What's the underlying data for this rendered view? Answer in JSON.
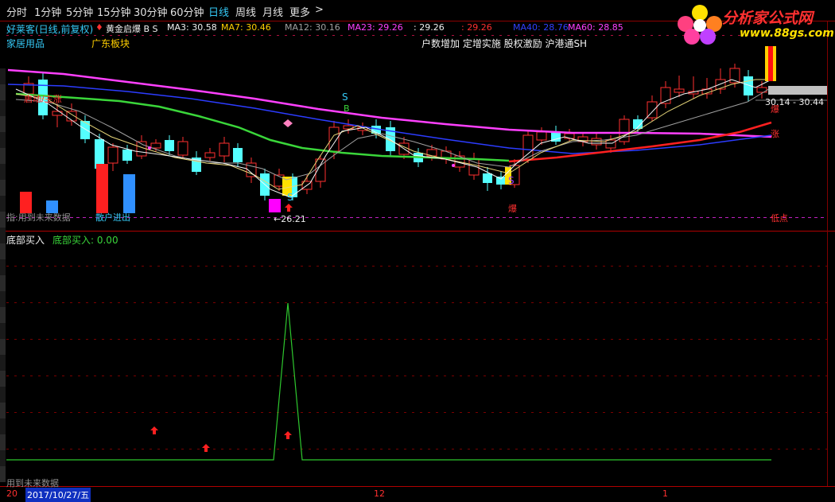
{
  "periods": [
    {
      "label": "分时",
      "active": false
    },
    {
      "label": "1分钟",
      "active": false
    },
    {
      "label": "5分钟",
      "active": false
    },
    {
      "label": "15分钟",
      "active": false
    },
    {
      "label": "30分钟",
      "active": false
    },
    {
      "label": "60分钟",
      "active": false
    },
    {
      "label": "日线",
      "active": true
    },
    {
      "label": "周线",
      "active": false
    },
    {
      "label": "月线",
      "active": false
    },
    {
      "label": "更多",
      "active": false
    }
  ],
  "more_arrow": ">",
  "header": {
    "stock": "好莱客(日线,前复权)",
    "indicator": "黄金启爆 B S",
    "ma3": "MA3: 30.58",
    "ma7": "MA7: 30.46",
    "ma12": "MA12: 30.16",
    "ma23": "MA23: 29.26",
    "v5": ": 29.26",
    "v6": ": 29.26",
    "ma40": "MA40: 28.76",
    "ma60": "MA60: 28.85"
  },
  "tags": {
    "industry": "家居用品",
    "region": "广东板块",
    "concepts": "户数增加 定增实施 股权激励 沪港通SH"
  },
  "annotations": {
    "label_s_top": "S",
    "label_s_low": "S",
    "label_s_right": "S",
    "label_b": "B",
    "low_price": "←26.21",
    "price_range": "30.14 - 30.44",
    "bao_mid": "爆",
    "bao_right": "爆",
    "zhang_right": "涨",
    "low_point": "低点",
    "retail_in": "散户进出",
    "future_data_top": "指:用到未来数据",
    "start_label": "启动/主涨"
  },
  "sub_panel": {
    "title": "底部买入",
    "value_label": "底部买入: 0.00",
    "future_note": "用到未来数据"
  },
  "datebar": {
    "left_num": "20",
    "date": "2017/10/27/五",
    "mid_tick": "12",
    "right_tick": "1"
  },
  "logo": {
    "name": "分析家公式网",
    "url": "www.88gs.com"
  },
  "colors": {
    "ma_magenta": "#ff40ff",
    "ma_green": "#3ad63a",
    "ma_blue": "#3040ff",
    "ma_red": "#ff2020",
    "up": "#ff3030",
    "down": "#54ffff",
    "accent": "#35c8f5"
  }
}
